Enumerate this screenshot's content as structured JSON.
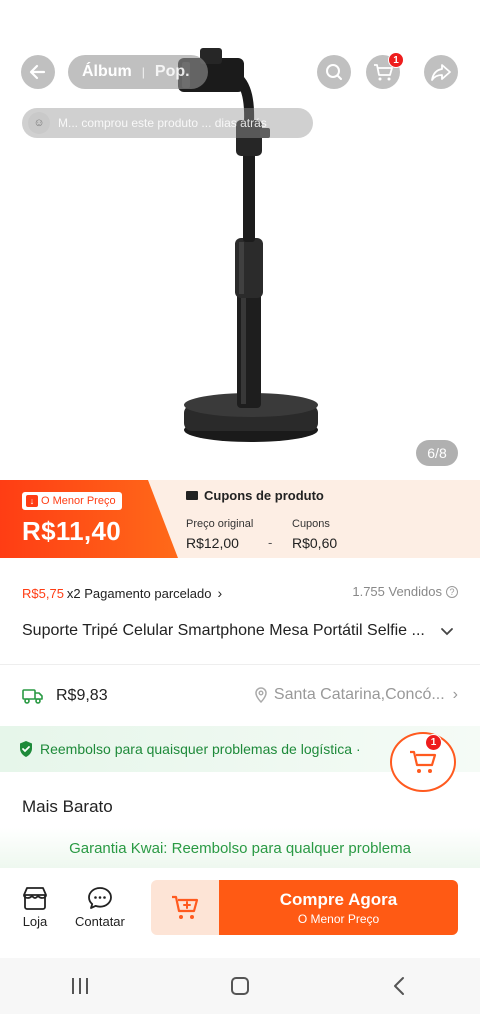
{
  "header": {
    "tabs": [
      "Álbum",
      "Pop."
    ],
    "cart_count": "1",
    "ticker_text": "M... comprou este produto ... dias atrás"
  },
  "gallery": {
    "counter": "6/8"
  },
  "price": {
    "lowest_tag": "O Menor Preço",
    "current": "R$11,40",
    "coupons_title": "Cupons de produto",
    "original_label": "Preço original",
    "original_value": "R$12,00",
    "minus": "-",
    "coupons_label": "Cupons",
    "coupons_value": "R$0,60"
  },
  "installment": {
    "price": "R$5,75",
    "text": "x2 Pagamento parcelado",
    "chevron": "›",
    "sold": "1.755 Vendidos"
  },
  "product": {
    "title": "Suporte Tripé Celular Smartphone Mesa Portátil Selfie ...",
    "chevron": "⌄"
  },
  "shipping": {
    "price": "R$9,83",
    "location": "Santa Catarina,Concó...",
    "chevron": "›"
  },
  "refund": {
    "text": "Reembolso para quaisquer problemas de logística ·",
    "cart_count": "1"
  },
  "section": {
    "cheapest": "Mais Barato"
  },
  "guarantee": {
    "text": "Garantia Kwai: Reembolso para qualquer problema"
  },
  "actions": {
    "store": "Loja",
    "contact": "Contatar",
    "buy_now": "Compre Agora",
    "buy_sub": "O Menor Preço"
  },
  "colors": {
    "accent": "#ff5a14",
    "price_red": "#ff3d14",
    "green": "#1e8a3a"
  },
  "icons": [
    "back-arrow-icon",
    "search-icon",
    "cart-icon",
    "share-icon",
    "truck-icon",
    "location-pin-icon",
    "shield-check-icon",
    "store-icon",
    "chat-icon",
    "add-cart-icon",
    "recent-apps-icon",
    "home-icon",
    "nav-back-icon"
  ]
}
